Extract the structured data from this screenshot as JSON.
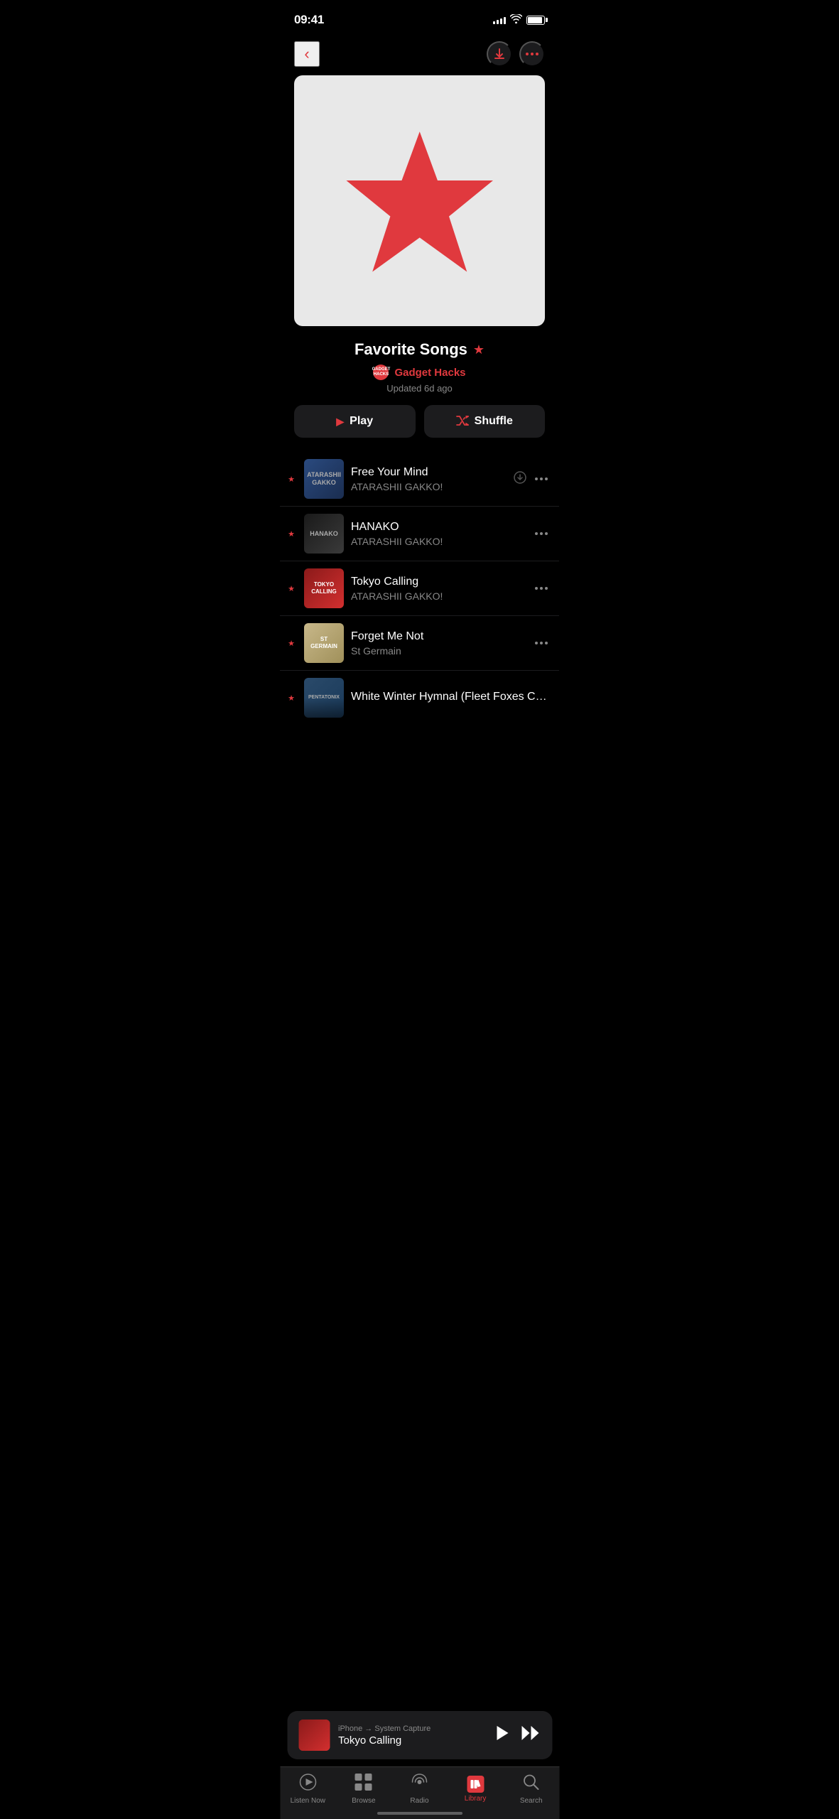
{
  "statusBar": {
    "time": "09:41",
    "signalBars": [
      4,
      6,
      8,
      10,
      12
    ],
    "batteryLevel": 90
  },
  "nav": {
    "backLabel": "‹",
    "downloadLabel": "↓",
    "moreLabel": "···"
  },
  "playlist": {
    "title": "Favorite Songs",
    "authorAvatar": "GADGET\nHACKS",
    "authorName": "Gadget Hacks",
    "updated": "Updated 6d ago"
  },
  "buttons": {
    "play": "Play",
    "shuffle": "Shuffle"
  },
  "songs": [
    {
      "title": "Free Your Mind",
      "artist": "ATARASHII GAKKO!",
      "favorited": true,
      "hasDownload": true,
      "thumbClass": "thumb-1"
    },
    {
      "title": "HANAKO",
      "artist": "ATARASHII GAKKO!",
      "favorited": true,
      "hasDownload": false,
      "thumbClass": "thumb-2"
    },
    {
      "title": "Tokyo Calling",
      "artist": "ATARASHII GAKKO!",
      "favorited": true,
      "hasDownload": false,
      "thumbClass": "thumb-3"
    },
    {
      "title": "Forget Me Not",
      "artist": "St Germain",
      "favorited": true,
      "hasDownload": false,
      "thumbClass": "thumb-4"
    },
    {
      "title": "White Winter Hymnal (Fleet Foxes Cover)",
      "artist": "",
      "favorited": true,
      "hasDownload": false,
      "thumbClass": "thumb-5",
      "partial": true
    }
  ],
  "miniPlayer": {
    "source": "iPhone → System Capture",
    "title": "Tokyo Calling"
  },
  "tabBar": {
    "tabs": [
      {
        "id": "listen-now",
        "label": "Listen Now",
        "icon": "▶",
        "active": false
      },
      {
        "id": "browse",
        "label": "Browse",
        "icon": "⊞",
        "active": false
      },
      {
        "id": "radio",
        "label": "Radio",
        "icon": "((·))",
        "active": false
      },
      {
        "id": "library",
        "label": "Library",
        "icon": "♪",
        "active": true
      },
      {
        "id": "search",
        "label": "Search",
        "icon": "⌕",
        "active": false
      }
    ]
  }
}
